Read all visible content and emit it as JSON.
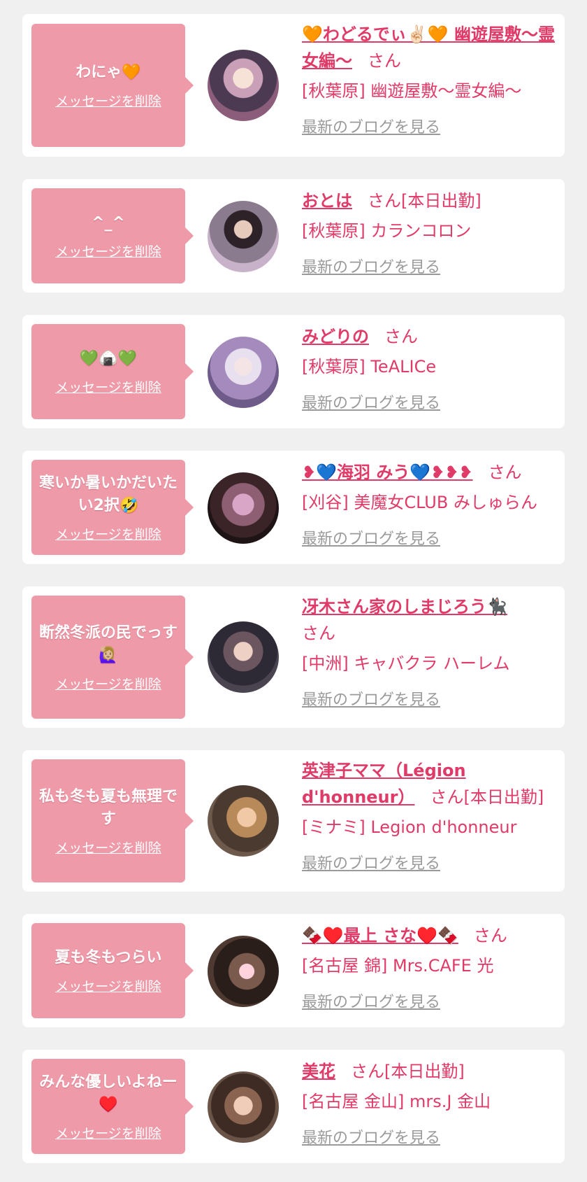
{
  "delete_label": "メッセージを削除",
  "blog_label": "最新のブログを見る",
  "colors": {
    "accent": "#e03b68",
    "bubble": "#ee9aa8",
    "card": "#ffffff",
    "background": "#f0f0f0",
    "link_gray": "#9a9a9a"
  },
  "items": [
    {
      "message": "わにゃ🧡",
      "name": "🧡わどるでぃ✌🏻🧡 幽遊屋敷〜霊女編〜",
      "suffix": "さん",
      "shop": "[秋葉原] 幽遊屋敷〜霊女編〜"
    },
    {
      "message": "^_^",
      "name": "おとは",
      "suffix": "さん[本日出勤]",
      "shop": "[秋葉原] カランコロン"
    },
    {
      "message": "💚🍙💚",
      "name": "みどりの",
      "suffix": "さん",
      "shop": "[秋葉原] TeALICe"
    },
    {
      "message": "寒いか暑いかだいたい2択🤣",
      "name": "❥💙海羽 みう💙❥❥❥",
      "suffix": "さん",
      "shop": "[刈谷] 美魔女CLUB みしゅらん"
    },
    {
      "message": "断然冬派の民でっす🙋🏼‍♀️",
      "name": "冴木さん家のしまじろう🐈‍⬛",
      "suffix": "さん",
      "shop": "[中洲] キャバクラ ハーレム"
    },
    {
      "message": "私も冬も夏も無理です",
      "name": "英津子ママ（Légion d'honneur）",
      "suffix": "さん[本日出勤]",
      "shop": "[ミナミ] Legion d'honneur"
    },
    {
      "message": "夏も冬もつらい",
      "name": "🍫♥️最上 さな♥️🍫",
      "suffix": "さん",
      "shop": "[名古屋 錦] Mrs.CAFE 光"
    },
    {
      "message": "みんな優しいよねー♥️",
      "name": "美花",
      "suffix": "さん[本日出勤]",
      "shop": "[名古屋 金山] mrs.J 金山"
    }
  ]
}
